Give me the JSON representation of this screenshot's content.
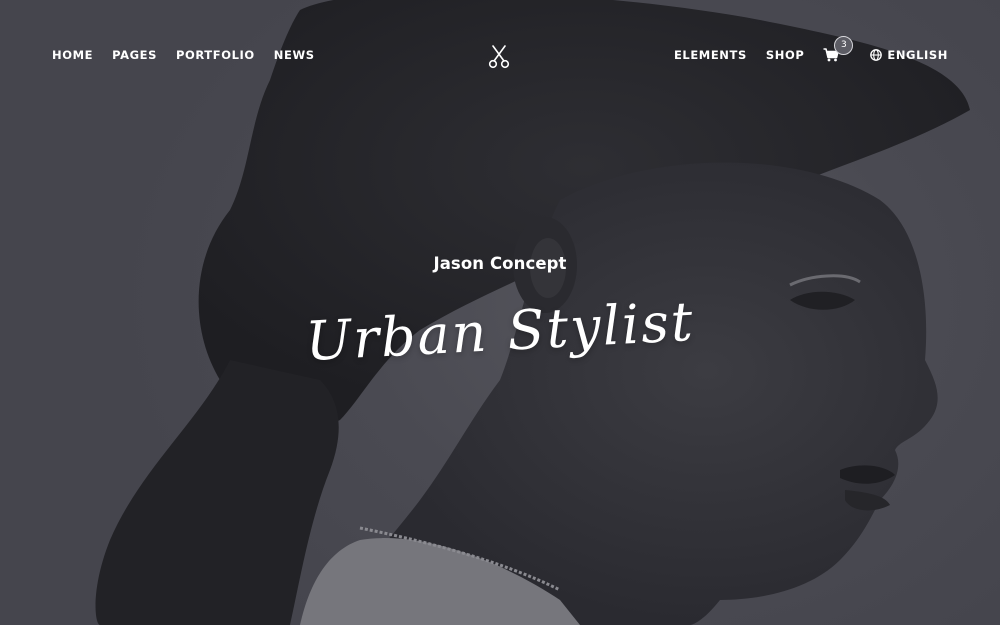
{
  "nav": {
    "left": [
      "HOME",
      "PAGES",
      "PORTFOLIO",
      "NEWS"
    ],
    "right": [
      "ELEMENTS",
      "SHOP"
    ],
    "cart_count": "3",
    "language": "ENGLISH"
  },
  "hero": {
    "subtitle": "Jason Concept",
    "title": "Urban Stylist"
  },
  "colors": {
    "background": "#4a4a52",
    "text": "#ffffff"
  },
  "icons": {
    "logo": "scissors-icon",
    "cart": "cart-icon",
    "language": "globe-icon"
  }
}
